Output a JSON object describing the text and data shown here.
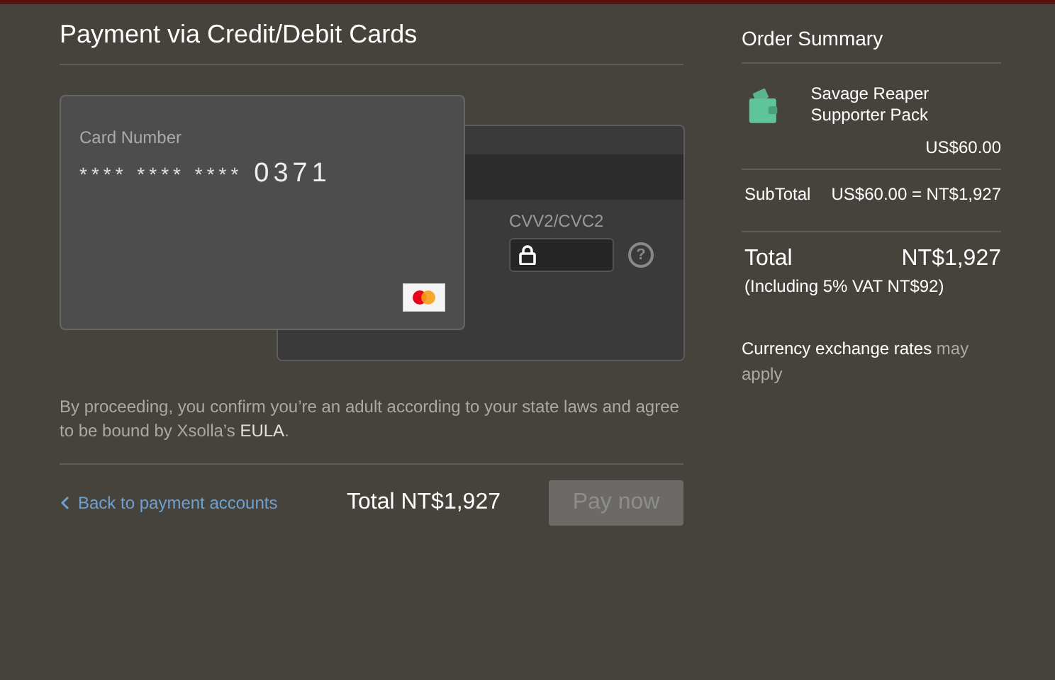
{
  "payment": {
    "title": "Payment via Credit/Debit Cards",
    "card": {
      "label": "Card Number",
      "masked": "**** **** ****",
      "last_digits": "0371"
    },
    "cvv": {
      "label": "CVV2/CVC2",
      "help": "?"
    },
    "consent": "By proceeding, you confirm you’re an adult according to your state laws and agree to be bound by Xsolla’s **EULA**.",
    "back_link": "Back to payment accounts",
    "total": "Total NT$1,927",
    "pay_button": {
      "label": "Pay now",
      "disabled": true
    }
  },
  "summary": {
    "title": "Order Summary",
    "item": {
      "name": "Savage Reaper Supporter Pack",
      "price": "US$60.00"
    },
    "subtotal": {
      "label": "SubTotal",
      "value": "US$60.00 = NT$1,927"
    },
    "total": {
      "label": "Total",
      "value": "NT$1,927",
      "vat": "(Including 5% VAT NT$92)"
    },
    "note": {
      "main": "Currency exchange rates",
      "muted": "may apply"
    }
  }
}
